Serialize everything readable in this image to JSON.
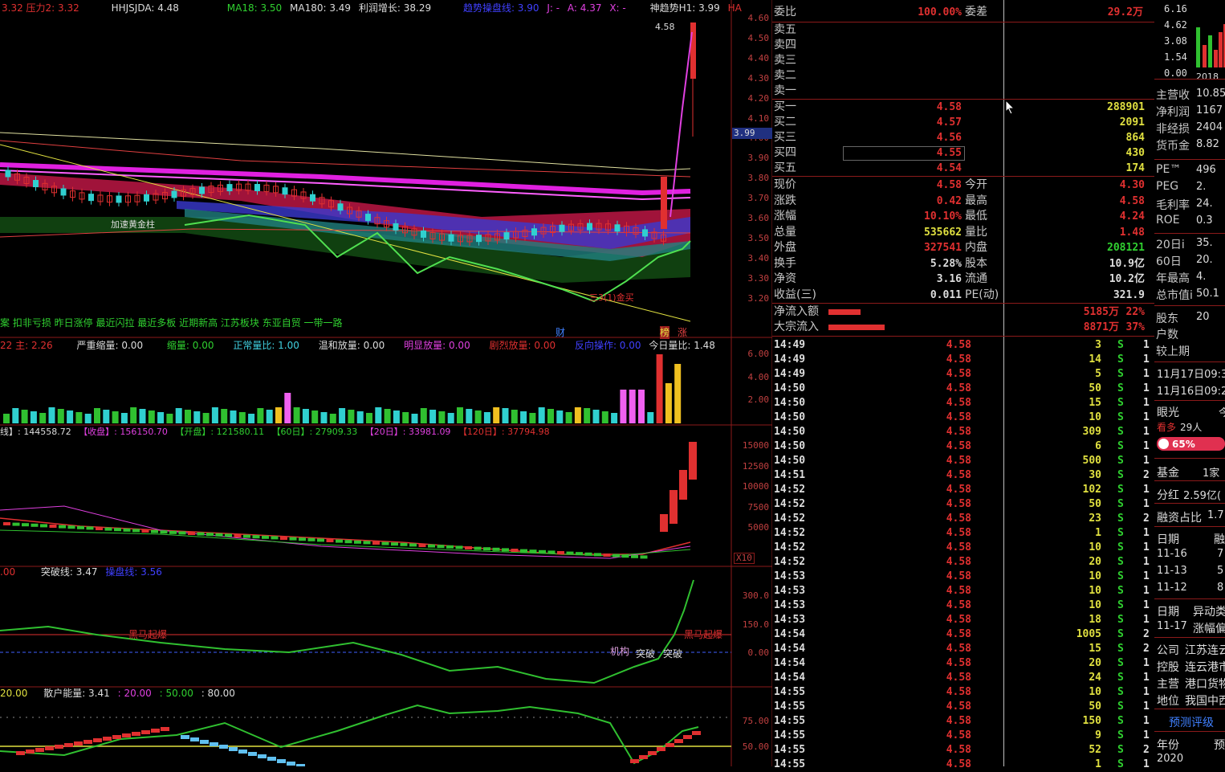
{
  "main_header": {
    "items": [
      "3.32 压力2: 3.32",
      "HHJSJDA: 4.48",
      "MA18: 3.50",
      "MA180: 3.49",
      "利润增长: 38.29",
      "趋势操盘线: 3.90",
      "J: -",
      "A: 4.37",
      "X: -",
      "神趋势H1: 3.99",
      "HA"
    ]
  },
  "price_axis": [
    "4.60",
    "4.50",
    "4.40",
    "4.30",
    "4.20",
    "4.10",
    "4.00",
    "3.90",
    "3.80",
    "3.70",
    "3.60",
    "3.50",
    "3.40",
    "3.30",
    "3.20"
  ],
  "price_marker": "3.99",
  "high_label": "4.58",
  "chart_annotations": {
    "label_a": "加速黄金柱",
    "label_b": "三3(1)金买",
    "fin": "财",
    "bang": "榜",
    "zhang": "涨"
  },
  "concept_line": "案 扣非亏损 昨日涨停 最近闪拉 最近多板 近期新高 江苏板块 东亚自贸 一带一路",
  "volume_header": [
    "22 主: 2.26",
    "严重缩量: 0.00",
    "缩量: 0.00",
    "正常量比: 1.00",
    "温和放量: 0.00",
    "明显放量: 0.00",
    "剧烈放量: 0.00",
    "反向操作: 0.00",
    "今日量比: 1.48"
  ],
  "volume_axis": [
    "6.00",
    "4.00",
    "2.00"
  ],
  "chip_header": [
    "线】: 144558.72",
    "【收盘】: 156150.70",
    "【开盘】: 121580.11",
    "【60日】: 27909.33",
    "【20日】: 33981.09",
    "【120日】: 37794.98"
  ],
  "chip_axis": [
    "15000",
    "12500",
    "10000",
    "7500",
    "5000"
  ],
  "chip_unit": "X10",
  "breakout_header": [
    ".00",
    "突破线: 3.47",
    "操盘线: 3.56"
  ],
  "breakout_axis": [
    "300.0",
    "150.0",
    "0.00"
  ],
  "breakout_labels": {
    "hm1": "黑马起爆",
    "hm2": "黑马起爆",
    "jg": "机构",
    "tp1": "突破",
    "tp2": "突破"
  },
  "energy_header": [
    "20.00",
    "散户能量: 3.41",
    ": 20.00",
    ": 50.00",
    ": 80.00"
  ],
  "energy_axis": [
    "75.00",
    "50.00"
  ],
  "quote": {
    "weibi_label": "委比",
    "weibi_value": "100.00%",
    "weicha_label": "委差",
    "weicha_value": "29.2万",
    "sells": [
      "卖五",
      "卖四",
      "卖三",
      "卖二",
      "卖一"
    ],
    "buys": [
      {
        "label": "买一",
        "price": "4.58",
        "vol": "288901"
      },
      {
        "label": "买二",
        "price": "4.57",
        "vol": "2091"
      },
      {
        "label": "买三",
        "price": "4.56",
        "vol": "864"
      },
      {
        "label": "买四",
        "price": "4.55",
        "vol": "430"
      },
      {
        "label": "买五",
        "price": "4.54",
        "vol": "174"
      }
    ],
    "stats": [
      {
        "l1": "现价",
        "v1": "4.58",
        "l2": "今开",
        "v2": "4.30",
        "c1": "red",
        "c2": "red"
      },
      {
        "l1": "涨跌",
        "v1": "0.42",
        "l2": "最高",
        "v2": "4.58",
        "c1": "red",
        "c2": "red"
      },
      {
        "l1": "涨幅",
        "v1": "10.10%",
        "l2": "最低",
        "v2": "4.24",
        "c1": "red",
        "c2": "red"
      },
      {
        "l1": "总量",
        "v1": "535662",
        "l2": "量比",
        "v2": "1.48",
        "c1": "yel",
        "c2": "red"
      },
      {
        "l1": "外盘",
        "v1": "327541",
        "l2": "内盘",
        "v2": "208121",
        "c1": "red",
        "c2": "grn"
      },
      {
        "l1": "换手",
        "v1": "5.28%",
        "l2": "股本",
        "v2": "10.9亿",
        "c1": "wht",
        "c2": "wht"
      },
      {
        "l1": "净资",
        "v1": "3.16",
        "l2": "流通",
        "v2": "10.2亿",
        "c1": "wht",
        "c2": "wht"
      },
      {
        "l1": "收益(三)",
        "v1": "0.011",
        "l2": "PE(动)",
        "v2": "321.9",
        "c1": "wht",
        "c2": "wht"
      }
    ],
    "flows": [
      {
        "label": "净流入额",
        "value": "5185万",
        "pct": "22%"
      },
      {
        "label": "大宗流入",
        "value": "8871万",
        "pct": "37%"
      }
    ],
    "ticks": [
      {
        "t": "14:49",
        "p": "4.58",
        "v": "3",
        "s": "S",
        "n": "1",
        "vc": "yel"
      },
      {
        "t": "14:49",
        "p": "4.58",
        "v": "14",
        "s": "S",
        "n": "1",
        "vc": "yel"
      },
      {
        "t": "14:49",
        "p": "4.58",
        "v": "5",
        "s": "S",
        "n": "1",
        "vc": "yel"
      },
      {
        "t": "14:50",
        "p": "4.58",
        "v": "50",
        "s": "S",
        "n": "1",
        "vc": "yel"
      },
      {
        "t": "14:50",
        "p": "4.58",
        "v": "15",
        "s": "S",
        "n": "1",
        "vc": "yel"
      },
      {
        "t": "14:50",
        "p": "4.58",
        "v": "10",
        "s": "S",
        "n": "1",
        "vc": "yel"
      },
      {
        "t": "14:50",
        "p": "4.58",
        "v": "309",
        "s": "S",
        "n": "1",
        "vc": "yel"
      },
      {
        "t": "14:50",
        "p": "4.58",
        "v": "6",
        "s": "S",
        "n": "1",
        "vc": "yel"
      },
      {
        "t": "14:50",
        "p": "4.58",
        "v": "500",
        "s": "S",
        "n": "1",
        "vc": "mag"
      },
      {
        "t": "14:51",
        "p": "4.58",
        "v": "30",
        "s": "S",
        "n": "2",
        "vc": "yel"
      },
      {
        "t": "14:52",
        "p": "4.58",
        "v": "102",
        "s": "S",
        "n": "1",
        "vc": "yel"
      },
      {
        "t": "14:52",
        "p": "4.58",
        "v": "50",
        "s": "S",
        "n": "1",
        "vc": "yel"
      },
      {
        "t": "14:52",
        "p": "4.58",
        "v": "23",
        "s": "S",
        "n": "2",
        "vc": "yel"
      },
      {
        "t": "14:52",
        "p": "4.58",
        "v": "1",
        "s": "S",
        "n": "1",
        "vc": "yel"
      },
      {
        "t": "14:52",
        "p": "4.58",
        "v": "10",
        "s": "S",
        "n": "1",
        "vc": "yel"
      },
      {
        "t": "14:52",
        "p": "4.58",
        "v": "20",
        "s": "S",
        "n": "1",
        "vc": "yel"
      },
      {
        "t": "14:53",
        "p": "4.58",
        "v": "10",
        "s": "S",
        "n": "1",
        "vc": "yel"
      },
      {
        "t": "14:53",
        "p": "4.58",
        "v": "10",
        "s": "S",
        "n": "1",
        "vc": "yel"
      },
      {
        "t": "14:53",
        "p": "4.58",
        "v": "10",
        "s": "S",
        "n": "1",
        "vc": "yel"
      },
      {
        "t": "14:53",
        "p": "4.58",
        "v": "18",
        "s": "S",
        "n": "1",
        "vc": "yel"
      },
      {
        "t": "14:54",
        "p": "4.58",
        "v": "1005",
        "s": "S",
        "n": "2",
        "vc": "mag"
      },
      {
        "t": "14:54",
        "p": "4.58",
        "v": "15",
        "s": "S",
        "n": "2",
        "vc": "yel"
      },
      {
        "t": "14:54",
        "p": "4.58",
        "v": "20",
        "s": "S",
        "n": "1",
        "vc": "yel"
      },
      {
        "t": "14:54",
        "p": "4.58",
        "v": "24",
        "s": "S",
        "n": "1",
        "vc": "yel"
      },
      {
        "t": "14:55",
        "p": "4.58",
        "v": "10",
        "s": "S",
        "n": "1",
        "vc": "yel"
      },
      {
        "t": "14:55",
        "p": "4.58",
        "v": "50",
        "s": "S",
        "n": "1",
        "vc": "yel"
      },
      {
        "t": "14:55",
        "p": "4.58",
        "v": "150",
        "s": "S",
        "n": "1",
        "vc": "yel"
      },
      {
        "t": "14:55",
        "p": "4.58",
        "v": "9",
        "s": "S",
        "n": "1",
        "vc": "yel"
      },
      {
        "t": "14:55",
        "p": "4.58",
        "v": "52",
        "s": "S",
        "n": "2",
        "vc": "yel"
      },
      {
        "t": "14:55",
        "p": "4.58",
        "v": "1",
        "s": "S",
        "n": "1",
        "vc": "yel"
      }
    ]
  },
  "right_panel": {
    "mini_axis": [
      "6.16",
      "4.62",
      "3.08",
      "1.54",
      "0.00"
    ],
    "mini_year": "2018",
    "rows": [
      {
        "l": "主营收",
        "v": "10.85"
      },
      {
        "l": "净利润",
        "v": "1167"
      },
      {
        "l": "非经损",
        "v": "2404"
      },
      {
        "l": "货币金",
        "v": "8.82"
      },
      {
        "l": "PE™",
        "v": "496"
      },
      {
        "l": "PEG",
        "v": "2."
      },
      {
        "l": "毛利率",
        "v": "24."
      },
      {
        "l": "ROE",
        "v": "0.3"
      },
      {
        "l": "20日i",
        "v": "35."
      },
      {
        "l": "60日",
        "v": "20."
      },
      {
        "l": "年最高",
        "v": "4."
      },
      {
        "l": "总市值i",
        "v": "50.1"
      },
      {
        "l": "股东",
        "v": "20"
      },
      {
        "l": "户数",
        "v": ""
      },
      {
        "l": "较上期",
        "v": ""
      }
    ],
    "dates": [
      "11月17日09:3",
      "11月16日09:2"
    ],
    "eye_label": "眼光",
    "eye_value": "今",
    "bull_label": "看多",
    "bull_count": "29人",
    "bull_pct": "65%",
    "fund_label": "基金",
    "fund_value": "1家",
    "div_label": "分红",
    "div_value": "2.59亿(",
    "margin_label": "融资占比",
    "margin_value": "1.7",
    "date_hdr": "日期",
    "date_hdr_v": "融",
    "date_rows": [
      {
        "d": "11-16",
        "v": "7"
      },
      {
        "d": "11-13",
        "v": "5"
      },
      {
        "d": "11-12",
        "v": "8"
      }
    ],
    "abn_hdr": "日期",
    "abn_hdr_v": "异动类",
    "abn_row": {
      "d": "11-17",
      "v": "涨幅偏"
    },
    "company": [
      {
        "l": "公司",
        "v": "江苏连云"
      },
      {
        "l": "控股",
        "v": "连云港市"
      },
      {
        "l": "主营",
        "v": "港口货物"
      },
      {
        "l": "地位",
        "v": "我国中西"
      }
    ],
    "forecast": "预测评级",
    "year_label": "年份",
    "year_label_v": "预",
    "year_value": "2020"
  },
  "colors": {
    "up": "#e03030",
    "down": "#30d0d0",
    "grid": "#8b1a1a",
    "green": "#30c030",
    "magenta": "#e040e0"
  }
}
